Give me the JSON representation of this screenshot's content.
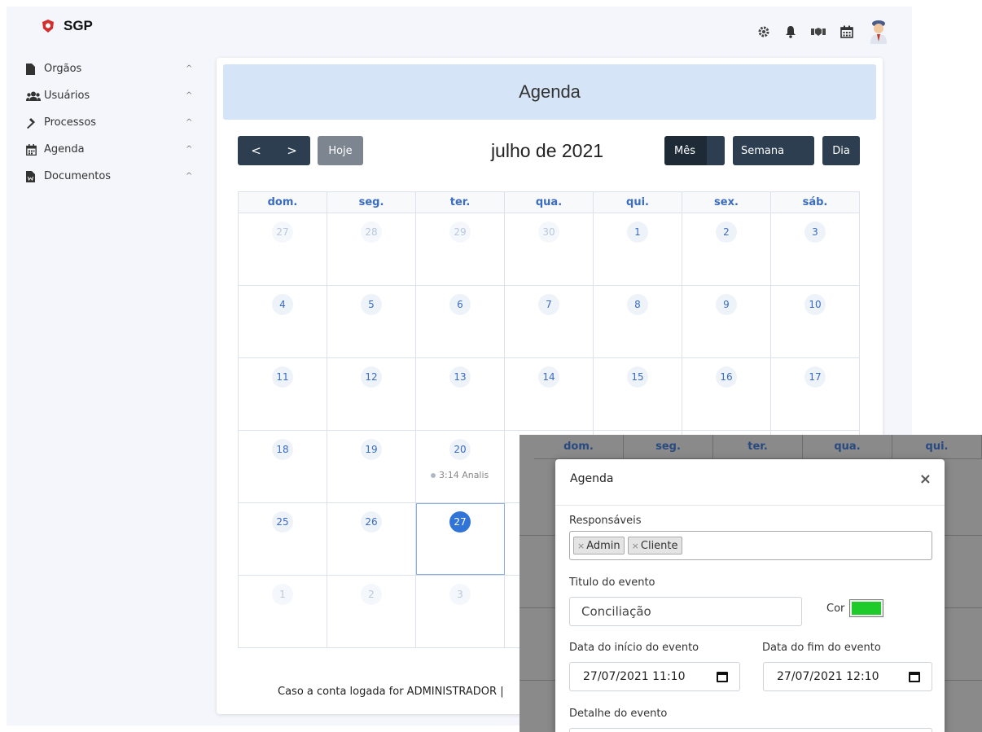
{
  "brand": {
    "name": "SGP",
    "color": "#d32f2f"
  },
  "top_icons": [
    "gear-icon",
    "bell-icon",
    "handshake-icon",
    "calendar-icon",
    "user-avatar"
  ],
  "sidebar": {
    "items": [
      {
        "label": "Orgãos",
        "icon": "file-icon"
      },
      {
        "label": "Usuários",
        "icon": "users-icon"
      },
      {
        "label": "Processos",
        "icon": "gavel-icon"
      },
      {
        "label": "Agenda",
        "icon": "calendar-icon"
      },
      {
        "label": "Documentos",
        "icon": "word-file-icon"
      }
    ],
    "chevron": "^"
  },
  "card": {
    "title": "Agenda"
  },
  "toolbar": {
    "prev": "<",
    "next": ">",
    "today": "Hoje",
    "title": "julho de 2021",
    "views": {
      "month": "Mês",
      "week": "Semana",
      "day": "Dia"
    }
  },
  "calendar": {
    "days_of_week": [
      "dom.",
      "seg.",
      "ter.",
      "qua.",
      "qui.",
      "sex.",
      "sáb."
    ],
    "weeks": [
      [
        "27",
        "28",
        "29",
        "30",
        "1",
        "2",
        "3"
      ],
      [
        "4",
        "5",
        "6",
        "7",
        "8",
        "9",
        "10"
      ],
      [
        "11",
        "12",
        "13",
        "14",
        "15",
        "16",
        "17"
      ],
      [
        "18",
        "19",
        "20",
        "",
        "",
        "",
        ""
      ],
      [
        "25",
        "26",
        "27",
        "",
        "",
        "",
        ""
      ],
      [
        "1",
        "2",
        "3",
        "",
        "",
        "",
        ""
      ]
    ],
    "event_20": "3:14 Analis"
  },
  "footnote": "Caso a conta logada for ADMINISTRADOR |",
  "overlay": {
    "days_of_week": [
      "dom.",
      "seg.",
      "ter.",
      "qua.",
      "qui."
    ]
  },
  "modal": {
    "title": "Agenda",
    "close": "×",
    "responsaveis_label": "Responsáveis",
    "tags": [
      "Admin",
      "Cliente"
    ],
    "tag_remove": "×",
    "titulo_label": "Titulo do evento",
    "titulo_value": "Conciliação",
    "cor_label": "Cor",
    "cor_value": "#1ecb2b",
    "inicio_label": "Data do início do evento",
    "inicio_value": "27/07/2021 11:10",
    "fim_label": "Data do fim do evento",
    "fim_value": "27/07/2021 12:10",
    "detalhe_label": "Detalhe do evento"
  }
}
